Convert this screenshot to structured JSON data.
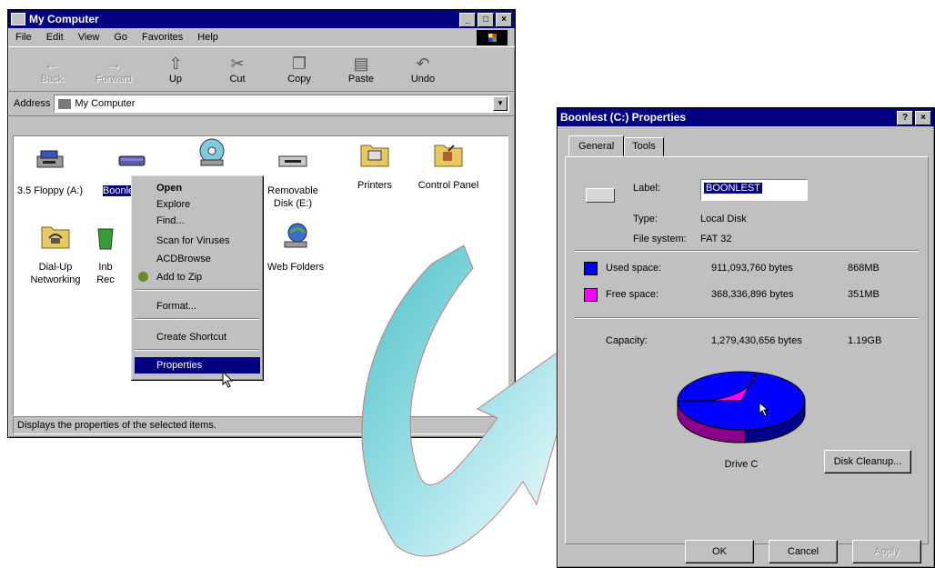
{
  "explorer": {
    "title": "My Computer",
    "menu": [
      "File",
      "Edit",
      "View",
      "Go",
      "Favorites",
      "Help"
    ],
    "toolbar": [
      {
        "label": "Back",
        "icon": "back-arrow-icon",
        "disabled": true
      },
      {
        "label": "Forward",
        "icon": "forward-arrow-icon",
        "disabled": true
      },
      {
        "label": "Up",
        "icon": "up-folder-icon",
        "disabled": false
      },
      {
        "label": "Cut",
        "icon": "scissors-icon",
        "disabled": false
      },
      {
        "label": "Copy",
        "icon": "copy-icon",
        "disabled": false
      },
      {
        "label": "Paste",
        "icon": "paste-icon",
        "disabled": false
      },
      {
        "label": "Undo",
        "icon": "undo-icon",
        "disabled": false
      }
    ],
    "address_label": "Address",
    "address_value": "My Computer",
    "icons": [
      {
        "label": "3.5 Floppy (A:)",
        "icon": "floppy-drive-icon"
      },
      {
        "label": "Boonlest (C:)",
        "icon": "hard-drive-icon"
      },
      {
        "label": "",
        "icon": "cd-drive-icon"
      },
      {
        "label": "Removable Disk (E:)",
        "icon": "removable-disk-icon"
      },
      {
        "label": "Printers",
        "icon": "printers-folder-icon"
      },
      {
        "label": "Control Panel",
        "icon": "control-panel-icon"
      },
      {
        "label": "Dial-Up Networking",
        "icon": "dialup-networking-icon"
      },
      {
        "label": "Inb Rec",
        "icon": "recycle-bin-icon"
      },
      {
        "label": "Web Folders",
        "icon": "web-folders-icon"
      }
    ],
    "context_menu": [
      "Open",
      "Explore",
      "Find...",
      "Scan for Viruses",
      "ACDBrowse",
      "Add to Zip",
      "Format...",
      "Create Shortcut",
      "Properties"
    ],
    "status": "Displays the properties of the selected items."
  },
  "dialog": {
    "title": "Boonlest (C:) Properties",
    "tabs": [
      "General",
      "Tools"
    ],
    "label_caption": "Label:",
    "label_value": "BOONLEST",
    "type_caption": "Type:",
    "type_value": "Local Disk",
    "fs_caption": "File system:",
    "fs_value": "FAT 32",
    "used_caption": "Used space:",
    "used_bytes": "911,093,760 bytes",
    "used_size": "868MB",
    "free_caption": "Free space:",
    "free_bytes": "368,336,896 bytes",
    "free_size": "351MB",
    "capacity_caption": "Capacity:",
    "capacity_bytes": "1,279,430,656 bytes",
    "capacity_size": "1.19GB",
    "drive_caption": "Drive C",
    "disk_cleanup": "Disk Cleanup...",
    "ok": "OK",
    "cancel": "Cancel",
    "apply": "Apply",
    "used_fraction": 0.712,
    "colors": {
      "used": "#0000ff",
      "free": "#ff00ff",
      "title": "#000080"
    }
  }
}
